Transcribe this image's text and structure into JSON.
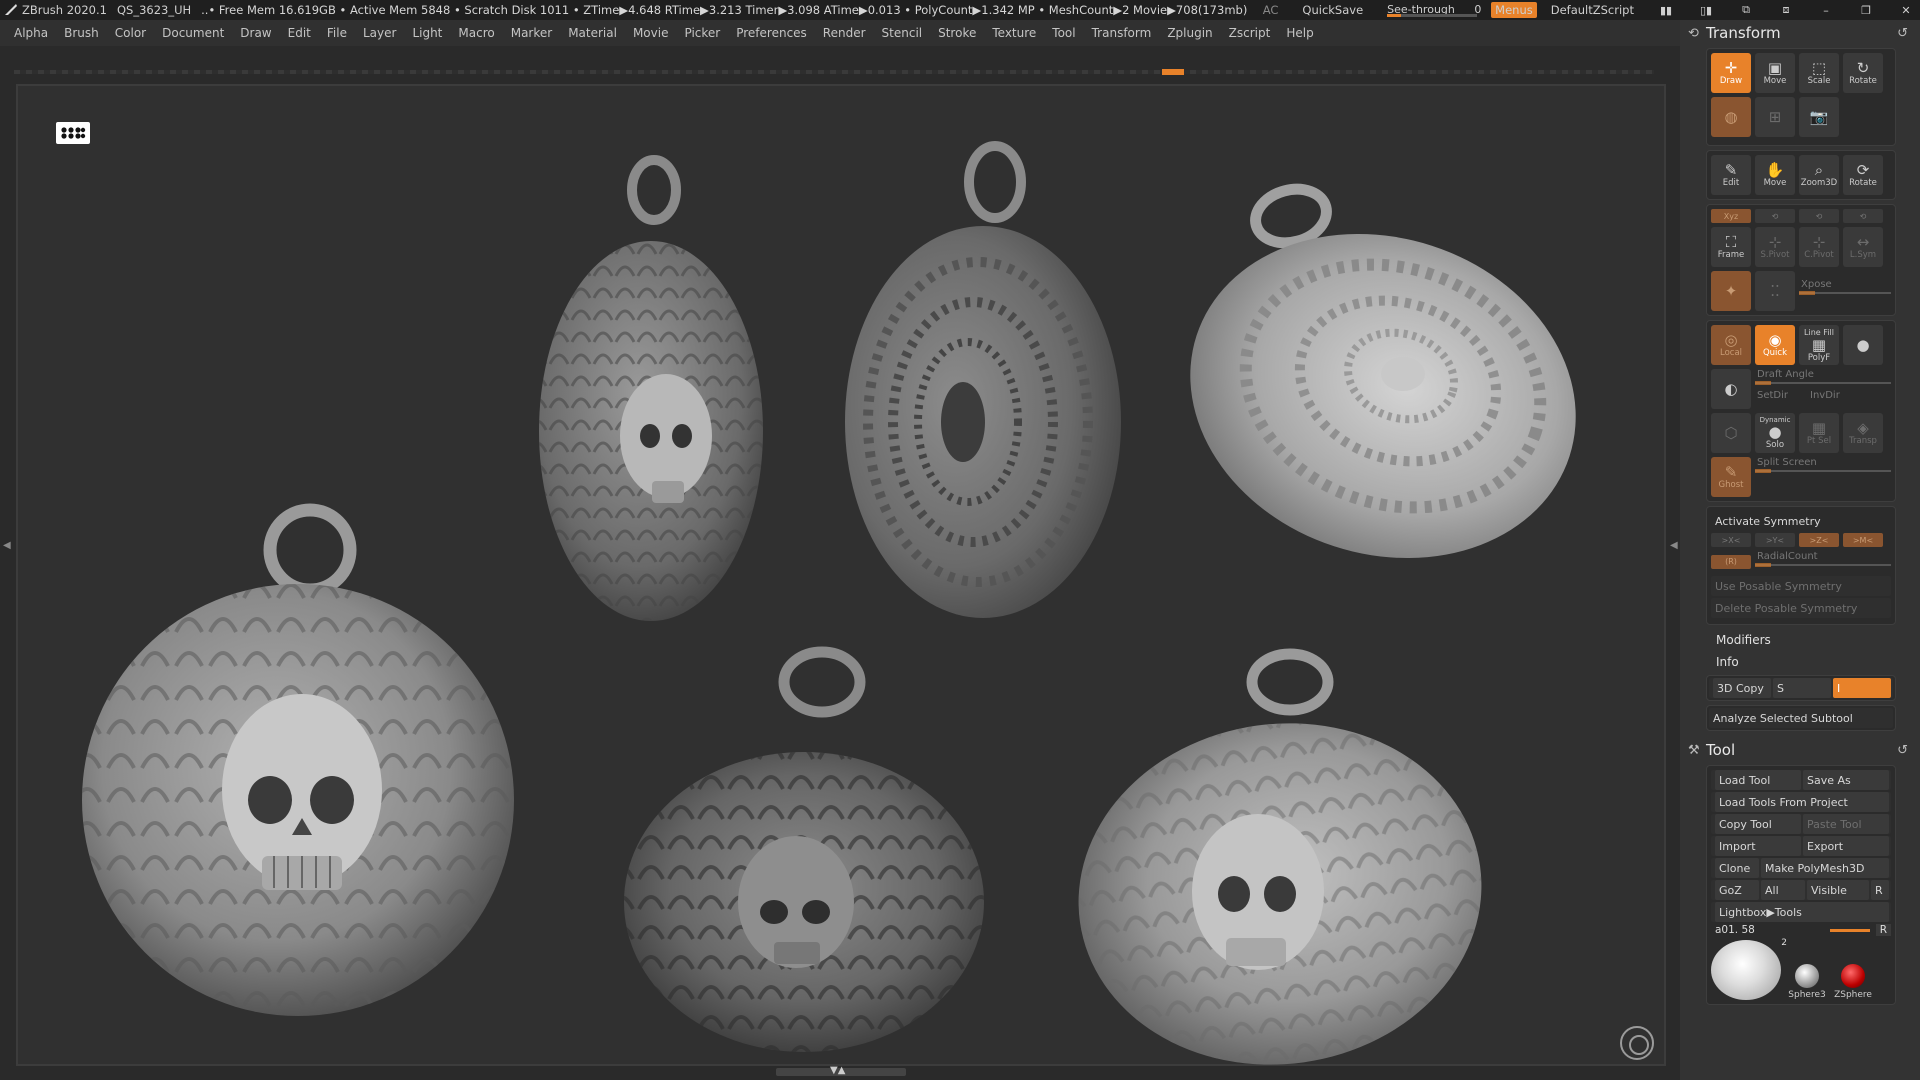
{
  "titlebar": {
    "app": "ZBrush 2020.1",
    "doc": "QS_3623_UH",
    "stats": "..• Free Mem 16.619GB • Active Mem 5848 • Scratch Disk 1011 • ZTime▶4.648 RTime▶3.213 Timer▶3.098 ATime▶0.013 • PolyCount▶1.342 MP • MeshCount▶2  Movie▶708(173mb)",
    "ac": "AC",
    "quicksave": "QuickSave",
    "see_through_label": "See-through",
    "see_through_value": "0",
    "menus": "Menus",
    "script": "DefaultZScript"
  },
  "menubar": [
    "Alpha",
    "Brush",
    "Color",
    "Document",
    "Draw",
    "Edit",
    "File",
    "Layer",
    "Light",
    "Macro",
    "Marker",
    "Material",
    "Movie",
    "Picker",
    "Preferences",
    "Render",
    "Stencil",
    "Stroke",
    "Texture",
    "Tool",
    "Transform",
    "Zplugin",
    "Zscript",
    "Help"
  ],
  "transform": {
    "title": "Transform",
    "row1": [
      {
        "label": "Draw",
        "icon": "draw-icon",
        "active": true
      },
      {
        "label": "Move",
        "icon": "move-icon"
      },
      {
        "label": "Scale",
        "icon": "scale-icon"
      },
      {
        "label": "Rotate",
        "icon": "rotate-icon"
      }
    ],
    "row3": [
      {
        "label": "Edit"
      },
      {
        "label": "Move"
      },
      {
        "label": "Zoom3D"
      },
      {
        "label": "Rotate"
      }
    ],
    "row4": [
      {
        "label": "Frame"
      },
      {
        "label": "S.Pivot"
      },
      {
        "label": "C.Pivot"
      },
      {
        "label": "L.Sym"
      }
    ],
    "xpose": "Xpose",
    "row_local": [
      {
        "label": "Local"
      },
      {
        "label": "Quick",
        "active": true
      },
      {
        "label": "PolyF",
        "top": "Line Fill"
      }
    ],
    "draft_angle": "Draft Angle",
    "setdir": "SetDir",
    "invdir": "InvDir",
    "dynamic": "Dynamic",
    "solo": "Solo",
    "ptsel": "Pt Sel",
    "transp": "Transp",
    "ghost": "Ghost",
    "split_screen": "Split Screen"
  },
  "symmetry": {
    "title": "Activate Symmetry",
    "axes": [
      ">X<",
      ">Y<",
      ">Z<",
      ">M<"
    ],
    "r": "(R)",
    "radial": "RadialCount",
    "posable": "Use Posable Symmetry",
    "delete": "Delete Posable Symmetry"
  },
  "modifiers": "Modifiers",
  "info": "Info",
  "copy3d": {
    "label": "3D Copy",
    "s": "S",
    "i": "I"
  },
  "analyze": "Analyze Selected Subtool",
  "tool": {
    "title": "Tool",
    "rows": [
      [
        "Load Tool",
        "Save As"
      ],
      [
        "Load Tools From Project"
      ],
      [
        "Copy Tool",
        "Paste Tool"
      ],
      [
        "Import",
        "Export"
      ],
      [
        "Clone",
        "Make PolyMesh3D"
      ],
      [
        "GoZ",
        "All",
        "Visible",
        "R"
      ],
      [
        "Lightbox▶Tools"
      ]
    ],
    "current": "a01. 58",
    "r": "R",
    "count": "2",
    "thumbs": [
      "Sphere3",
      "ZSphere"
    ]
  },
  "colors": {
    "accent": "#e8822a",
    "panel": "#333333",
    "canvas": "#303030"
  }
}
